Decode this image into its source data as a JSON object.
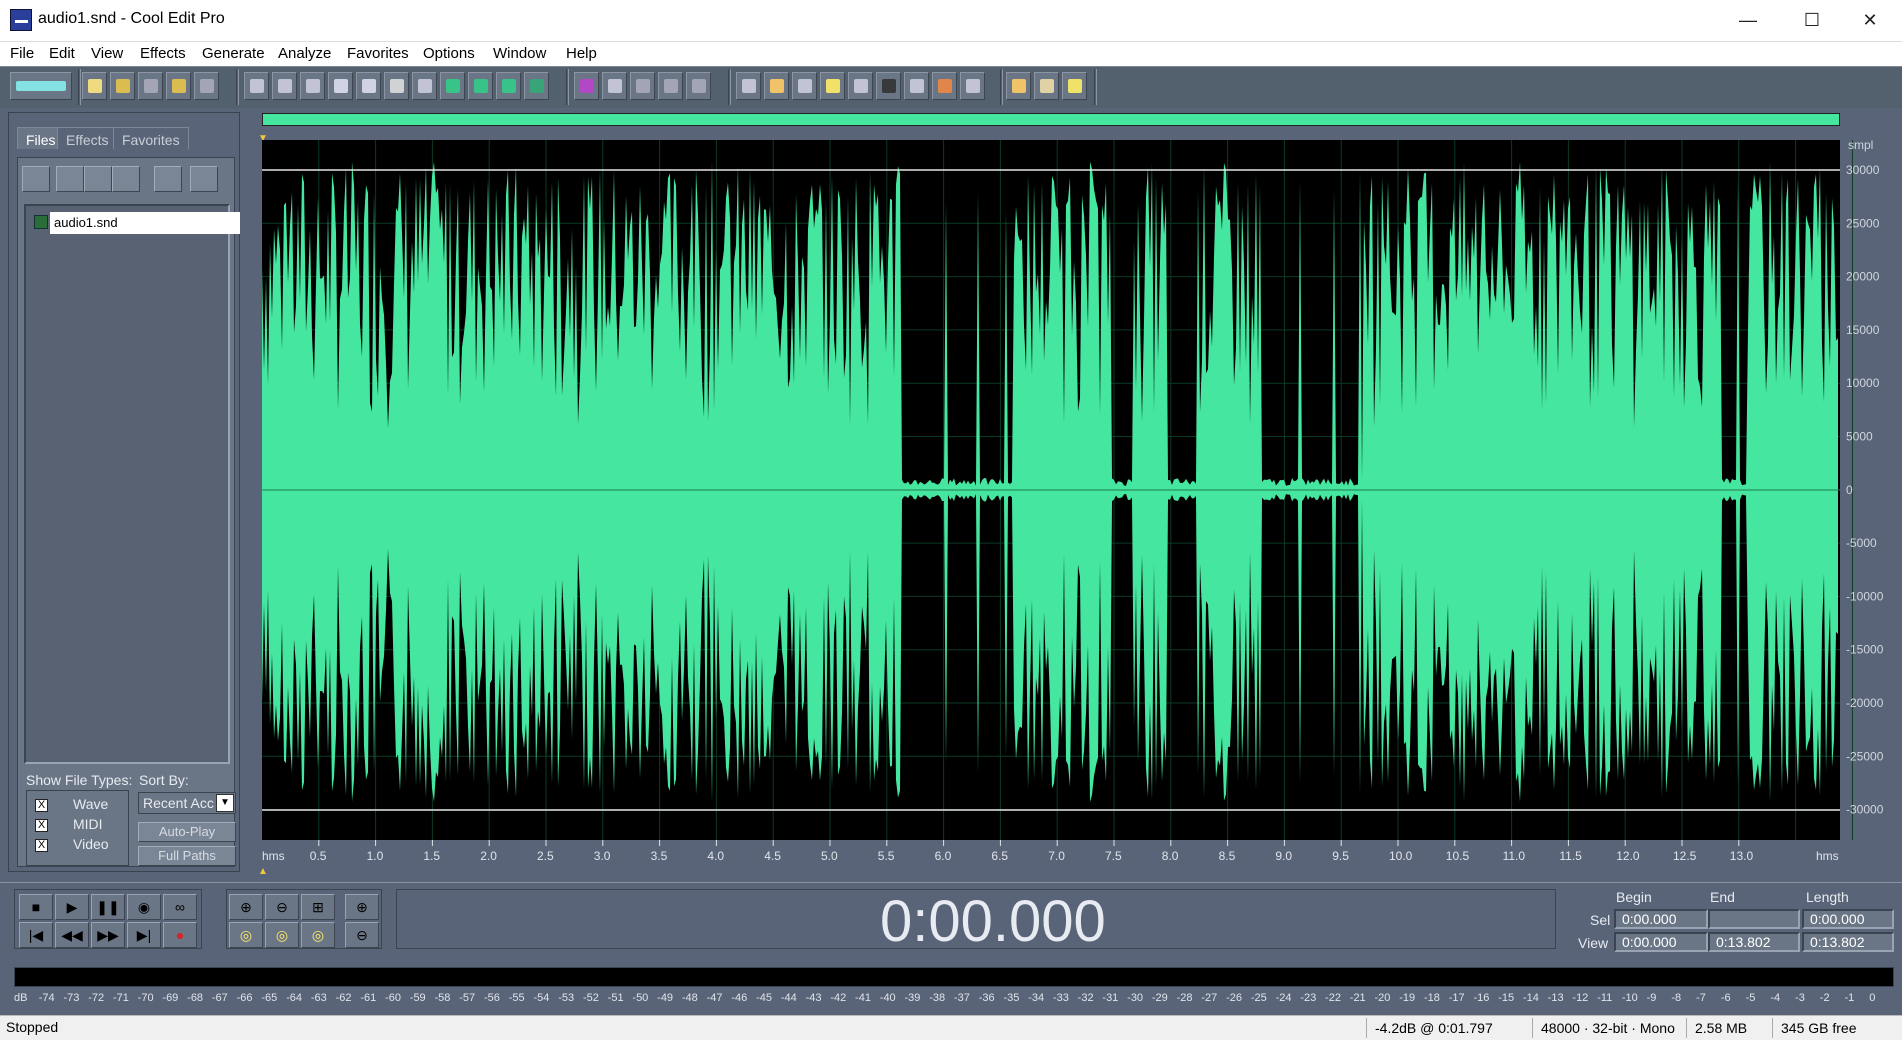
{
  "window": {
    "title": "audio1.snd - Cool Edit Pro",
    "minimize": "—",
    "maximize": "☐",
    "close": "✕"
  },
  "menu": [
    "File",
    "Edit",
    "View",
    "Effects",
    "Generate",
    "Analyze",
    "Favorites",
    "Options",
    "Window",
    "Help"
  ],
  "organizer": {
    "tabs": [
      "Files",
      "Effects",
      "Favorites"
    ],
    "file": "audio1.snd",
    "show_types_label": "Show File Types:",
    "types": [
      {
        "label": "Wave",
        "checked": "X"
      },
      {
        "label": "MIDI",
        "checked": "X"
      },
      {
        "label": "Video",
        "checked": "X"
      }
    ],
    "sort_label": "Sort By:",
    "sort_value": "Recent Acc",
    "autoplay": "Auto-Play",
    "fullpaths": "Full Paths"
  },
  "waveform": {
    "color": "#45e6a0",
    "y_unit": "smpl",
    "y_ticks": [
      "30000",
      "25000",
      "20000",
      "15000",
      "10000",
      "5000",
      "0",
      "-5000",
      "-10000",
      "-15000",
      "-20000",
      "-25000",
      "-30000"
    ],
    "x_unit_left": "hms",
    "x_unit_right": "hms",
    "x_ticks": [
      "0.5",
      "1.0",
      "1.5",
      "2.0",
      "2.5",
      "3.0",
      "3.5",
      "4.0",
      "4.5",
      "5.0",
      "5.5",
      "6.0",
      "6.5",
      "7.0",
      "7.5",
      "8.0",
      "8.5",
      "9.0",
      "9.5",
      "10.0",
      "10.5",
      "11.0",
      "11.5",
      "12.0",
      "12.5",
      "13.0"
    ]
  },
  "transport": {
    "time": "0:00.000",
    "headers": {
      "begin": "Begin",
      "end": "End",
      "length": "Length"
    },
    "sel": {
      "label": "Sel",
      "begin": "0:00.000",
      "end": "",
      "length": "0:00.000"
    },
    "view": {
      "label": "View",
      "begin": "0:00.000",
      "end": "0:13.802",
      "length": "0:13.802"
    }
  },
  "levels": {
    "ticks": [
      "dB",
      "-74",
      "-73",
      "-72",
      "-71",
      "-70",
      "-69",
      "-68",
      "-67",
      "-66",
      "-65",
      "-64",
      "-63",
      "-62",
      "-61",
      "-60",
      "-59",
      "-58",
      "-57",
      "-56",
      "-55",
      "-54",
      "-53",
      "-52",
      "-51",
      "-50",
      "-49",
      "-48",
      "-47",
      "-46",
      "-45",
      "-44",
      "-43",
      "-42",
      "-41",
      "-40",
      "-39",
      "-38",
      "-37",
      "-36",
      "-35",
      "-34",
      "-33",
      "-32",
      "-31",
      "-30",
      "-29",
      "-28",
      "-27",
      "-26",
      "-25",
      "-24",
      "-23",
      "-22",
      "-21",
      "-20",
      "-19",
      "-18",
      "-17",
      "-16",
      "-15",
      "-14",
      "-13",
      "-12",
      "-11",
      "-10",
      "-9",
      "-8",
      "-7",
      "-6",
      "-5",
      "-4",
      "-3",
      "-2",
      "-1",
      "0"
    ]
  },
  "status": {
    "state": "Stopped",
    "cursor": "-4.2dB @   0:01.797",
    "format": "48000 · 32-bit · Mono",
    "size": "2.58 MB",
    "free": "345 GB free"
  }
}
